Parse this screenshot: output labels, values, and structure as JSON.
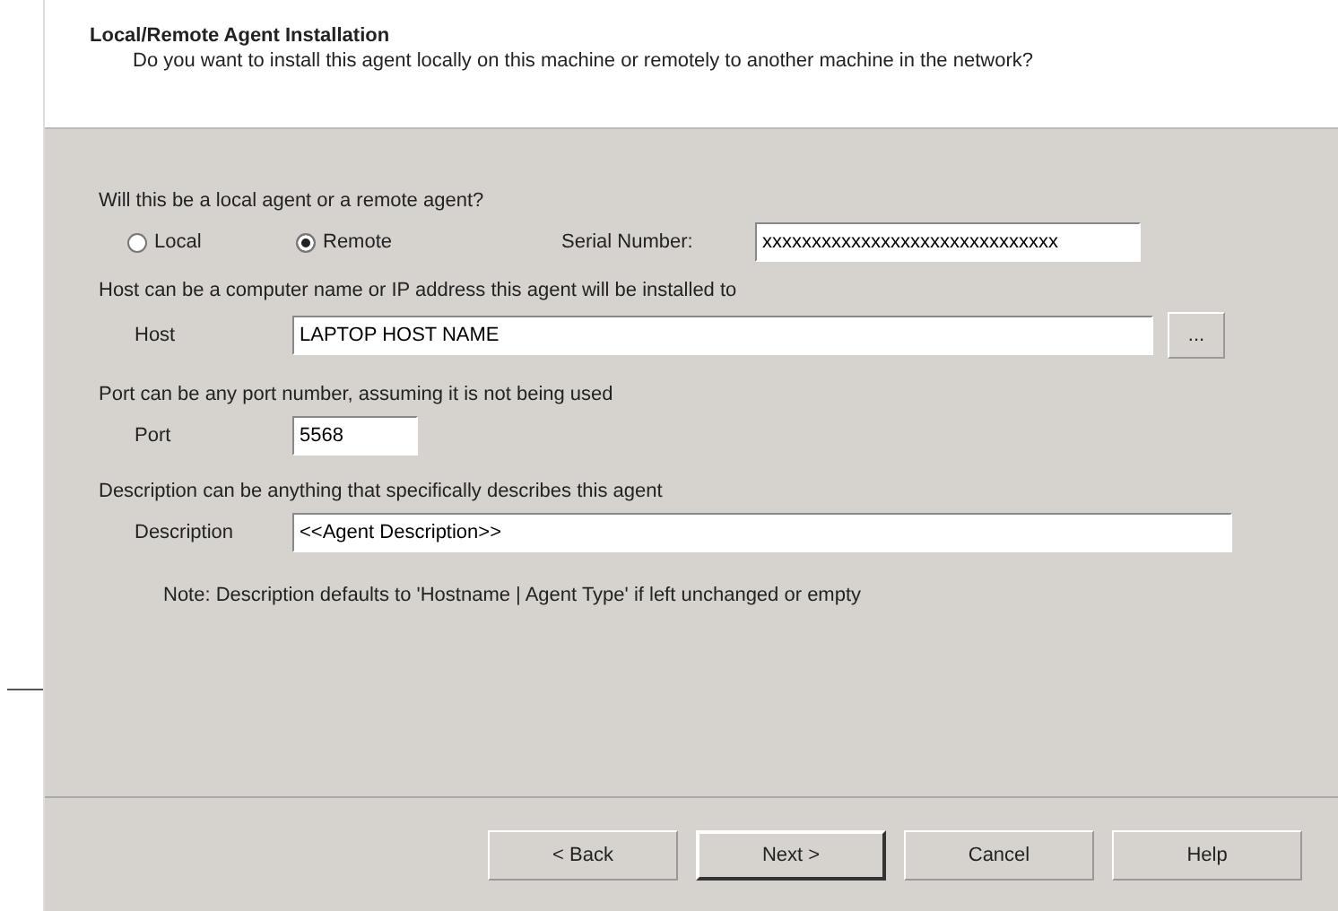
{
  "header": {
    "title": "Local/Remote Agent Installation",
    "subtitle": "Do you want to install this agent locally on this machine or remotely to another machine in the network?"
  },
  "agent_type": {
    "question": "Will this be a local agent or a remote agent?",
    "options": [
      {
        "label": "Local",
        "selected": false
      },
      {
        "label": "Remote",
        "selected": true
      }
    ],
    "serial_label": "Serial Number:",
    "serial_value": "xxxxxxxxxxxxxxxxxxxxxxxxxxxxxx"
  },
  "host": {
    "hint": "Host can be a computer name or IP address this agent will be installed to",
    "label": "Host",
    "value": "LAPTOP HOST NAME",
    "browse": "..."
  },
  "port": {
    "hint": "Port can be any port number, assuming it is not being used",
    "label": "Port",
    "value": "5568"
  },
  "description": {
    "hint": "Description can be anything that specifically describes this agent",
    "label": "Description",
    "value": "<<Agent Description>>",
    "note": "Note: Description defaults to 'Hostname | Agent Type' if left unchanged or empty"
  },
  "buttons": [
    {
      "label": "< Back",
      "default": false
    },
    {
      "label": "Next >",
      "default": true
    },
    {
      "label": "Cancel",
      "default": false
    },
    {
      "label": "Help",
      "default": false
    }
  ]
}
